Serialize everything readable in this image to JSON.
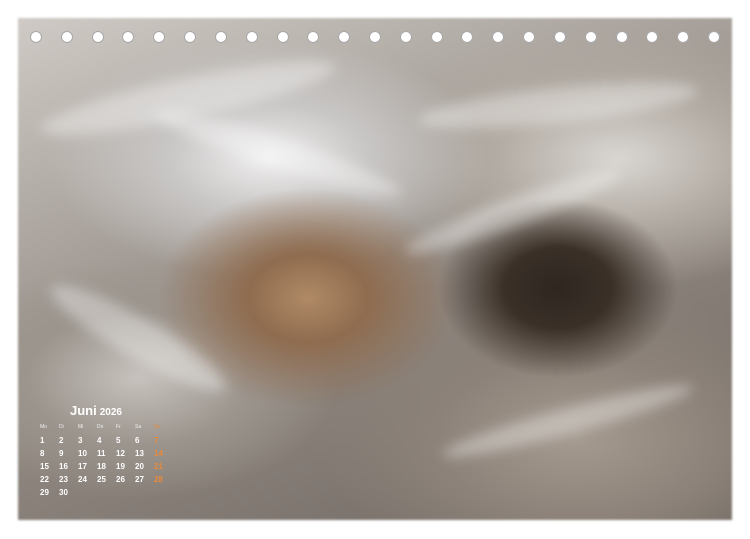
{
  "calendar": {
    "month": "Juni",
    "year": "2026",
    "weekdays": [
      "Mo",
      "Di",
      "Mi",
      "Do",
      "Fr",
      "Sa",
      "So"
    ],
    "weeks": [
      [
        "1",
        "2",
        "3",
        "4",
        "5",
        "6",
        "7"
      ],
      [
        "8",
        "9",
        "10",
        "11",
        "12",
        "13",
        "14"
      ],
      [
        "15",
        "16",
        "17",
        "18",
        "19",
        "20",
        "21"
      ],
      [
        "22",
        "23",
        "24",
        "25",
        "26",
        "27",
        "28"
      ],
      [
        "29",
        "30",
        "",
        "",
        "",
        "",
        ""
      ]
    ],
    "sunday_color": "#e98a3a"
  },
  "binding_holes": 23
}
